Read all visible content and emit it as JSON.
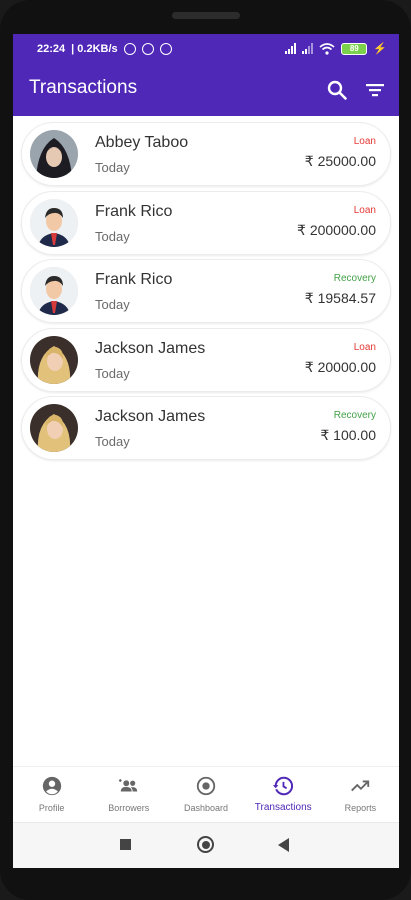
{
  "status_bar": {
    "time": "22:24",
    "network_speed": "| 0.2KB/s",
    "battery_level": "89",
    "icons": [
      "alarm-icon",
      "app-notification-icon",
      "app-notification-icon",
      "signal-icon",
      "signal-icon",
      "wifi-icon",
      "battery-icon",
      "charging-icon"
    ]
  },
  "app_bar": {
    "title": "Transactions",
    "background": "#5028b8",
    "actions": [
      "search-icon",
      "filter-icon"
    ]
  },
  "colors": {
    "primary": "#5028b8",
    "loan": "#e53935",
    "recovery": "#43a047"
  },
  "transactions": [
    {
      "name": "Abbey Taboo",
      "date": "Today",
      "type": "Loan",
      "amount": "₹ 25000.00",
      "avatar": "woman-hood"
    },
    {
      "name": "Frank Rico",
      "date": "Today",
      "type": "Loan",
      "amount": "₹ 200000.00",
      "avatar": "man-suit"
    },
    {
      "name": "Frank Rico",
      "date": "Today",
      "type": "Recovery",
      "amount": "₹ 19584.57",
      "avatar": "man-suit"
    },
    {
      "name": "Jackson James",
      "date": "Today",
      "type": "Loan",
      "amount": "₹ 20000.00",
      "avatar": "woman-blonde"
    },
    {
      "name": "Jackson James",
      "date": "Today",
      "type": "Recovery",
      "amount": "₹ 100.00",
      "avatar": "woman-blonde"
    }
  ],
  "bottom_nav": {
    "items": [
      {
        "label": "Profile",
        "icon": "account-circle-icon"
      },
      {
        "label": "Borrowers",
        "icon": "people-icon"
      },
      {
        "label": "Dashboard",
        "icon": "dashboard-circle-icon"
      },
      {
        "label": "Transactions",
        "icon": "history-icon"
      },
      {
        "label": "Reports",
        "icon": "trending-up-icon"
      }
    ],
    "active": "Transactions"
  },
  "system_nav": [
    "recents-square-icon",
    "home-circle-icon",
    "back-triangle-icon"
  ]
}
